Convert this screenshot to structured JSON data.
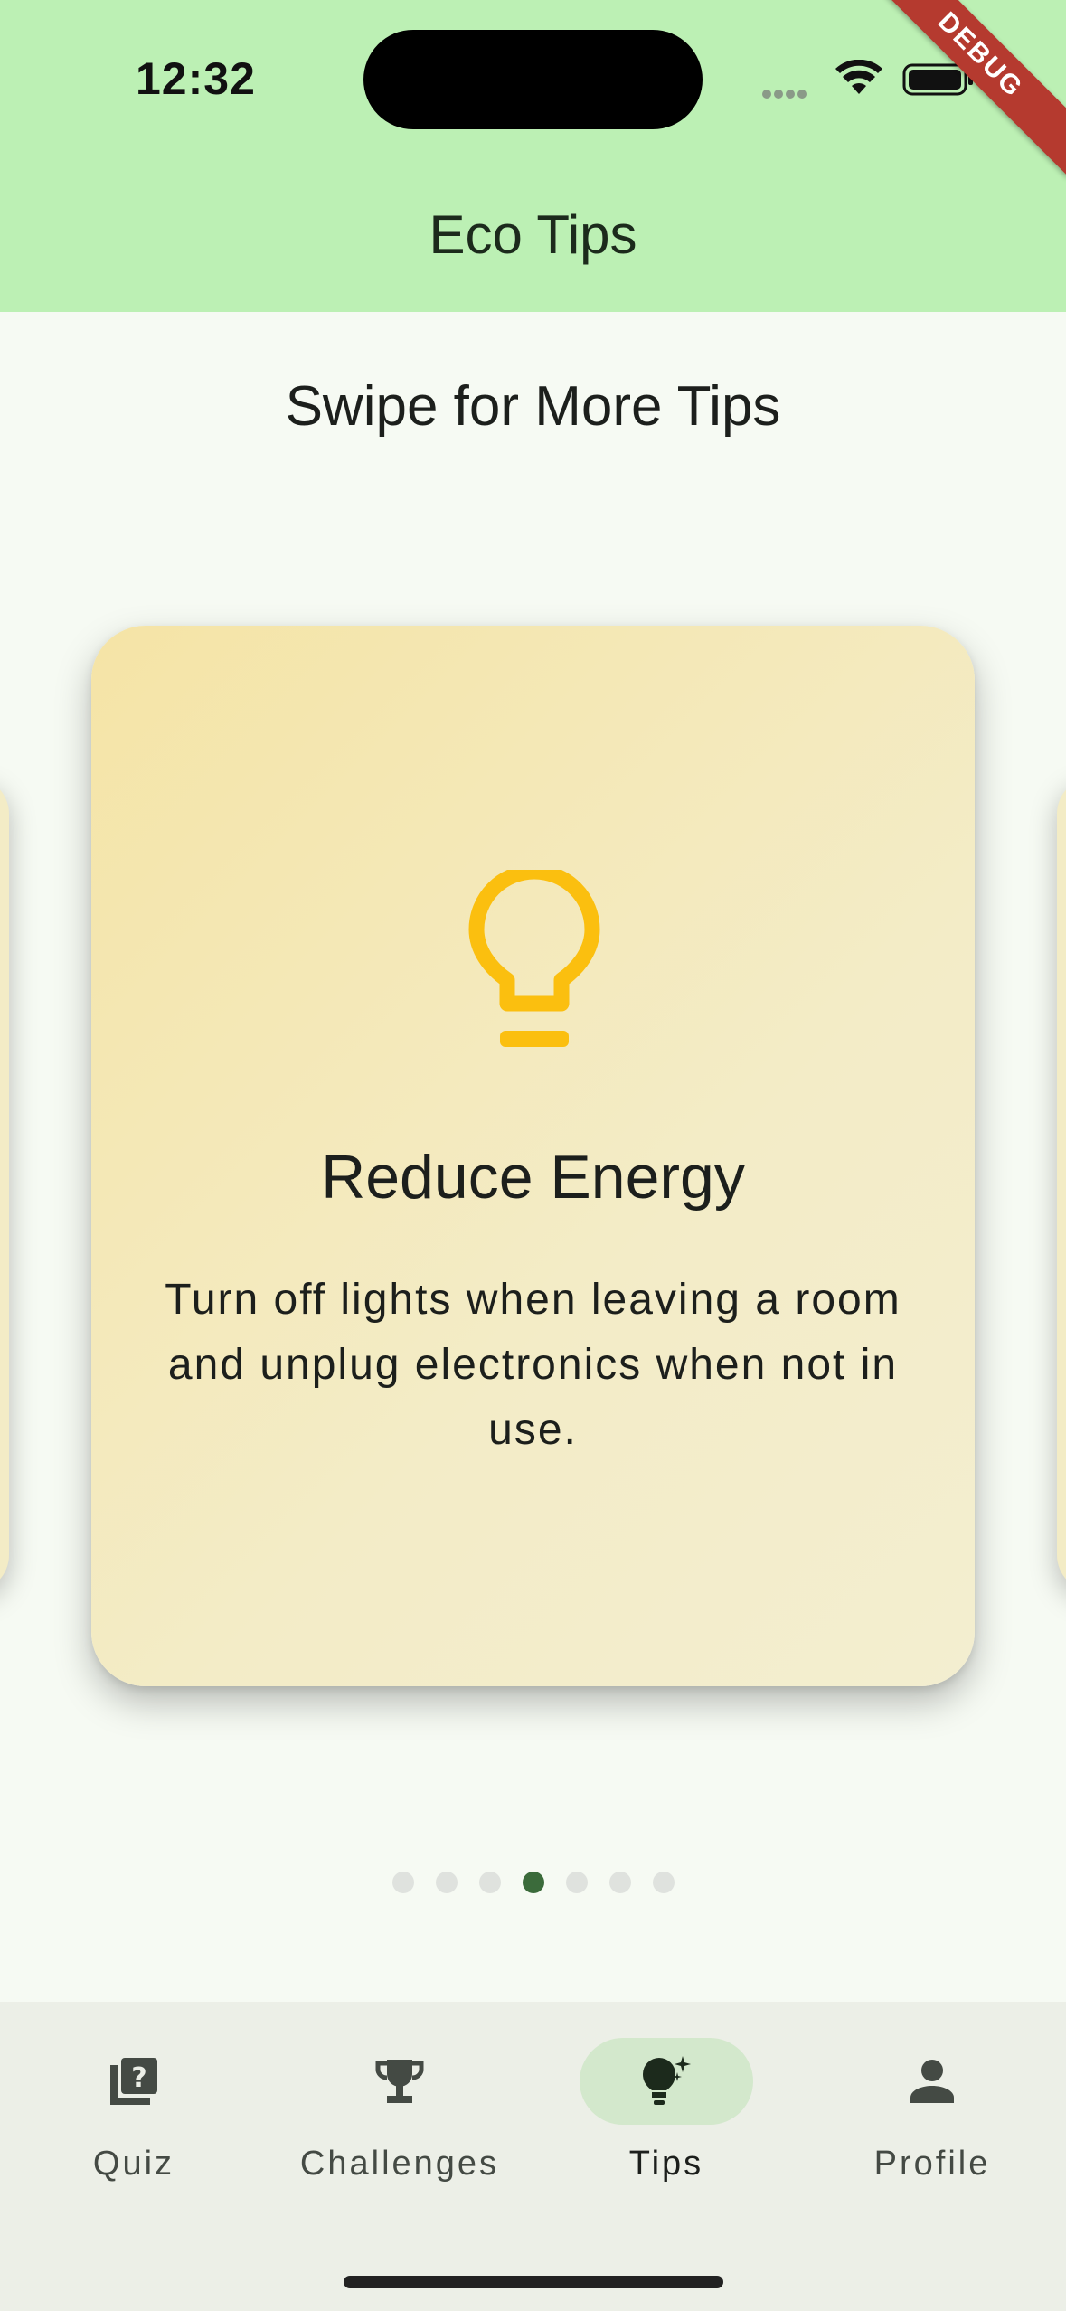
{
  "status_bar": {
    "time": "12:32",
    "debug_label": "DEBUG"
  },
  "header": {
    "title": "Eco Tips"
  },
  "main": {
    "subtitle": "Swipe for More Tips",
    "current_card": {
      "icon": "lightbulb-icon",
      "title": "Reduce Energy",
      "body": "Turn off lights when leaving a room and unplug electronics when not in use."
    },
    "pagination": {
      "total": 7,
      "active_index": 3
    }
  },
  "bottom_nav": {
    "items": [
      {
        "label": "Quiz",
        "icon": "quiz-icon"
      },
      {
        "label": "Challenges",
        "icon": "trophy-icon"
      },
      {
        "label": "Tips",
        "icon": "tips-lightbulb-icon",
        "active": true
      },
      {
        "label": "Profile",
        "icon": "person-icon"
      }
    ]
  },
  "colors": {
    "header_bg": "#bcf0b4",
    "card_bg": "#f3ecc7",
    "bulb": "#fbbf0f",
    "active_dot": "#3b6b3b",
    "nav_active_pill": "#d3e8cc"
  }
}
